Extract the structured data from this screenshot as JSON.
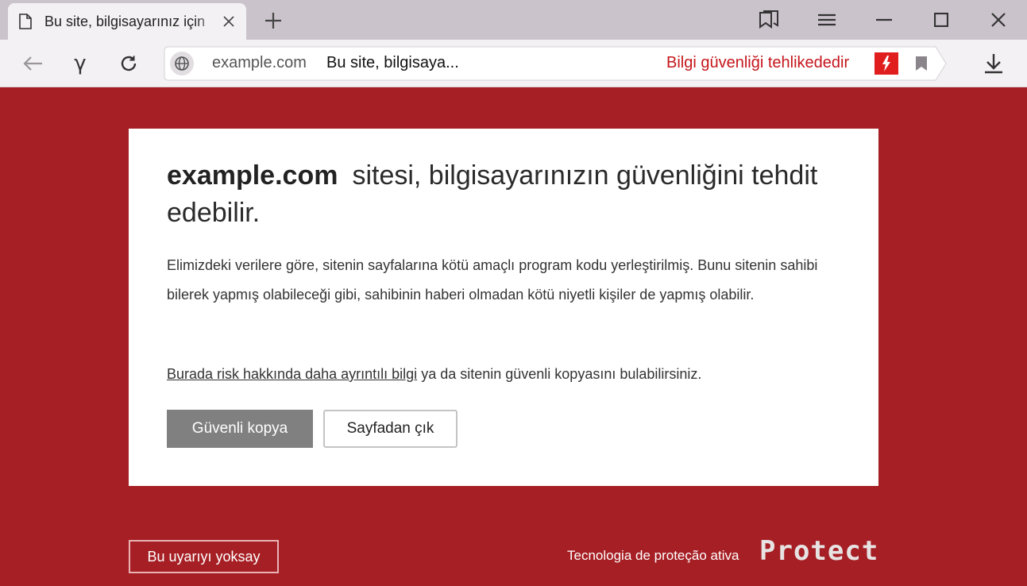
{
  "window": {
    "tab_title": "Bu site, bilgisayarınız için"
  },
  "omnibox": {
    "domain": "example.com",
    "page_title": "Bu site, bilgisaya...",
    "security_warning": "Bilgi güvenliği tehlikededir"
  },
  "card": {
    "heading_domain": "example.com",
    "heading_text": "sitesi, bilgisayarınızın güvenliğini tehdit edebilir.",
    "body": "Elimizdeki verilere göre, sitenin sayfalarına kötü amaçlı program kodu yerleştirilmiş. Bunu sitenin sahibi bilerek yapmış olabileceği gibi, sahibinin haberi olmadan kötü niyetli kişiler de yapmış olabilir.",
    "risk_link": "Burada risk hakkında daha ayrıntılı bilgi",
    "risk_suffix": " ya da sitenin güvenli kopyasını bulabilirsiniz.",
    "safe_copy_button": "Güvenli kopya",
    "leave_button": "Sayfadan çık"
  },
  "footer": {
    "ignore_button": "Bu uyarıyı yoksay",
    "tech_text": "Tecnologia de proteção ativa",
    "logo": "Protect"
  },
  "colors": {
    "page_background": "#a61f24",
    "warning_red": "#c5161c",
    "flash_badge": "#e01e1e"
  },
  "icons": {
    "tab_page": "document-icon",
    "tab_close": "close-icon",
    "new_tab": "plus-icon",
    "bookmarks_manager": "bookmarks-icon",
    "menu": "hamburger-menu-icon",
    "minimize": "minimize-icon",
    "maximize": "maximize-icon",
    "window_close": "window-close-icon",
    "back": "back-arrow-icon",
    "yandex": "yandex-logo-icon",
    "reload": "reload-icon",
    "site_info": "globe-icon",
    "protect_flash": "flash-icon",
    "bookmark": "bookmark-icon",
    "downloads": "download-icon"
  }
}
